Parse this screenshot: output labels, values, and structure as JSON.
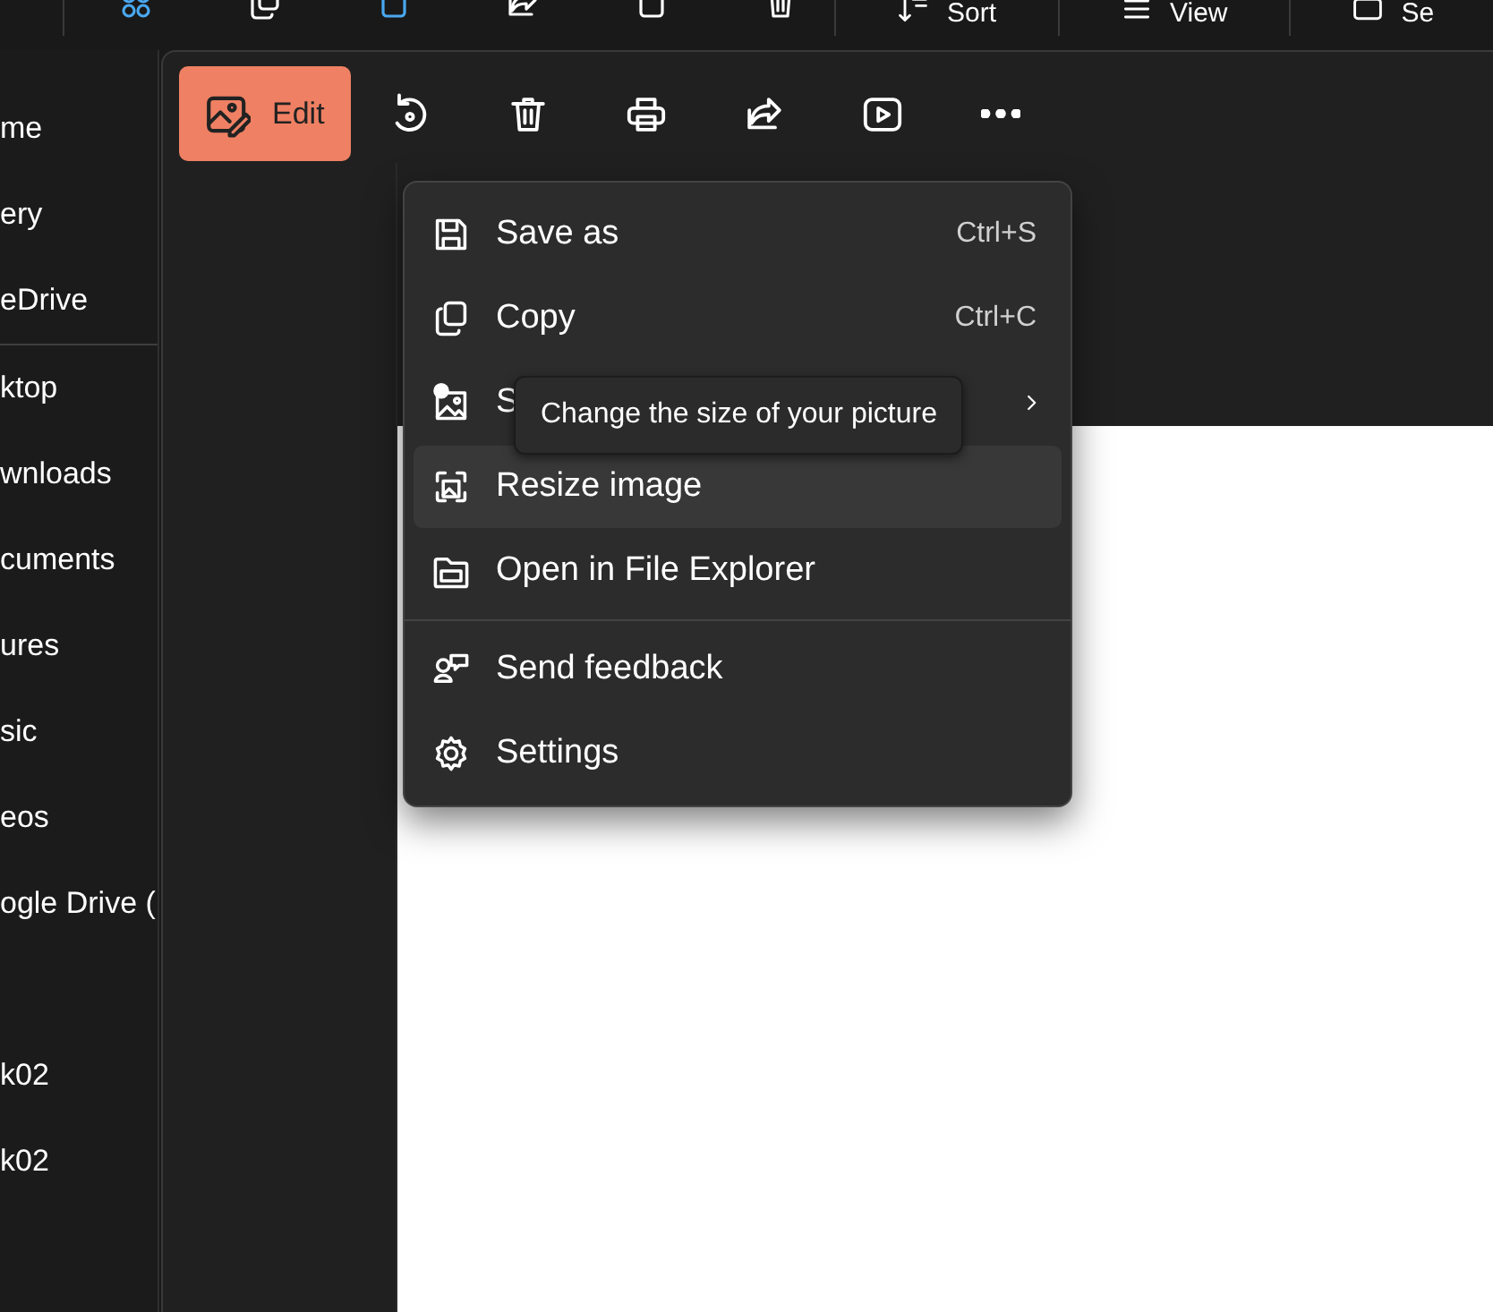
{
  "explorer_toolbar": {
    "items": [
      {
        "kind": "sort",
        "label": "Sort"
      },
      {
        "kind": "view",
        "label": "View"
      },
      {
        "kind": "select",
        "label": "Se"
      }
    ]
  },
  "sidebar": {
    "items": [
      {
        "kind": "item",
        "label": "me"
      },
      {
        "kind": "item",
        "label": "ery"
      },
      {
        "kind": "item",
        "label": "eDrive"
      },
      {
        "kind": "divider"
      },
      {
        "kind": "item",
        "label": "ktop"
      },
      {
        "kind": "item",
        "label": "wnloads"
      },
      {
        "kind": "item",
        "label": "cuments"
      },
      {
        "kind": "item",
        "label": "ures"
      },
      {
        "kind": "item",
        "label": "sic"
      },
      {
        "kind": "item",
        "label": "eos"
      },
      {
        "kind": "item",
        "label": "ogle Drive ("
      },
      {
        "kind": "spacer"
      },
      {
        "kind": "item",
        "label": "k02"
      },
      {
        "kind": "item",
        "label": "k02"
      }
    ]
  },
  "photos_toolbar": {
    "edit_button": {
      "label": "Edit"
    }
  },
  "menu": {
    "items": [
      {
        "kind": "item",
        "label": "Save as",
        "shortcut": "Ctrl+S",
        "selected": false
      },
      {
        "kind": "item",
        "label": "Copy",
        "shortcut": "Ctrl+C",
        "selected": false
      },
      {
        "kind": "submenu",
        "label": "S",
        "selected": false
      },
      {
        "kind": "item",
        "label": "Resize image",
        "selected": true
      },
      {
        "kind": "item",
        "label": "Open in File Explorer",
        "selected": false
      },
      {
        "kind": "separator"
      },
      {
        "kind": "item",
        "label": "Send feedback",
        "selected": false
      },
      {
        "kind": "item",
        "label": "Settings",
        "selected": false
      }
    ]
  },
  "tooltip": {
    "text": "Change the size of your picture"
  }
}
